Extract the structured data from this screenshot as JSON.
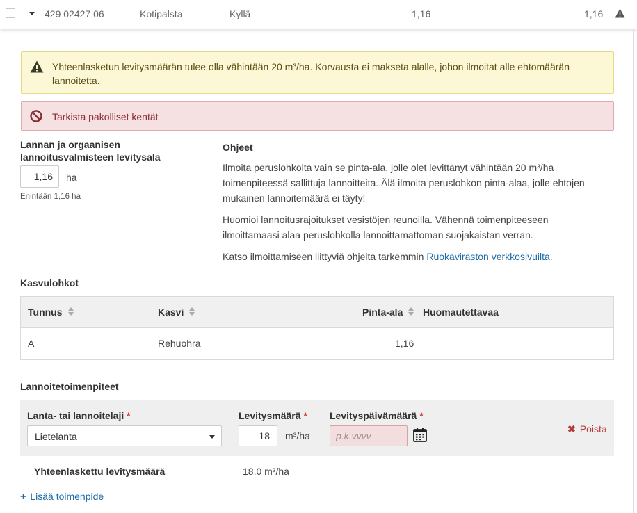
{
  "parcel_row": {
    "id": "429 02427 06",
    "name": "Kotipalsta",
    "flag": "Kyllä",
    "area_a": "1,16",
    "area_b": "1,16"
  },
  "alerts": {
    "warning": "Yhteenlasketun levitysmäärän tulee olla vähintään 20 m³/ha. Korvausta ei makseta alalle, johon ilmoitat alle ehtomäärän lannoitetta.",
    "danger": "Tarkista pakolliset kentät"
  },
  "area_field": {
    "label": "Lannan ja orgaanisen lannoitusvalmisteen levitysala",
    "value": "1,16",
    "unit": "ha",
    "max_note": "Enintään 1,16 ha"
  },
  "instructions": {
    "title": "Ohjeet",
    "p1": "Ilmoita peruslohkolta vain se pinta-ala, jolle olet levittänyt vähintään 20 m³/ha toimenpiteessä sallittuja lannoitteita. Älä ilmoita peruslohkon pinta-alaa, jolle ehtojen mukainen lannoitemäärä ei täyty!",
    "p2": "Huomioi lannoitusrajoitukset vesistöjen reunoilla. Vähennä toimenpiteeseen ilmoittamaasi alaa peruslohkolla lannoittamattoman suojakaistan verran.",
    "p3_prefix": "Katso ilmoittamiseen liittyviä ohjeita tarkemmin ",
    "p3_link": "Ruokaviraston verkkosivuilta",
    "p3_suffix": "."
  },
  "crops": {
    "title": "Kasvulohkot",
    "headers": [
      "Tunnus",
      "Kasvi",
      "Pinta-ala",
      "Huomautettavaa"
    ],
    "rows": [
      {
        "id": "A",
        "crop": "Rehuohra",
        "area": "1,16",
        "note": ""
      }
    ]
  },
  "measures": {
    "title": "Lannoitetoimenpiteet",
    "type_label": "Lanta- tai lannoitelaji",
    "type_value": "Lietelanta",
    "amount_label": "Levitysmäärä",
    "amount_value": "18",
    "amount_unit": "m³/ha",
    "date_label": "Levityspäivämäärä",
    "date_placeholder": "p.k.vvvv",
    "required_mark": "*",
    "remove_label": "Poista",
    "total_label": "Yhteenlaskettu levitysmäärä",
    "total_value": "18,0 m³/ha",
    "add_label": "Lisää toimenpide"
  },
  "colors": {
    "warning_bg": "#fcf8d5",
    "danger_bg": "#f5e0e2",
    "link": "#1e6ba5",
    "required": "#c9302c"
  },
  "icons": [
    "chevron-down-icon",
    "warning-triangle-icon",
    "ban-icon",
    "sort-icon",
    "calendar-icon",
    "remove-x-icon",
    "plus-icon"
  ]
}
